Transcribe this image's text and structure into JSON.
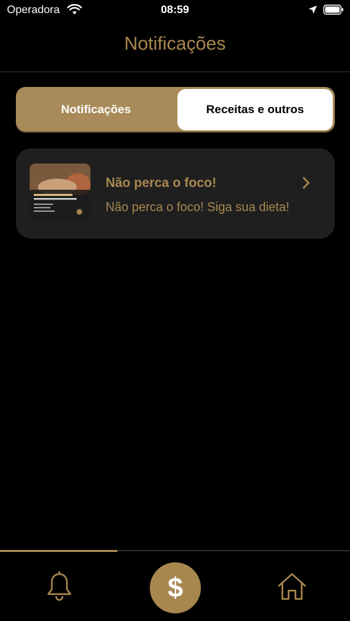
{
  "status_bar": {
    "carrier": "Operadora",
    "time": "08:59",
    "icons": [
      "wifi-icon",
      "location-arrow-icon",
      "battery-icon"
    ]
  },
  "header": {
    "title": "Notificações"
  },
  "segmented_control": {
    "tabs": [
      {
        "label": "Notificações",
        "selected": true
      },
      {
        "label": "Receitas e outros",
        "selected": false
      }
    ]
  },
  "notifications": [
    {
      "title": "Não perca o foco!",
      "body": "Não perca o foco! Siga sua dieta!",
      "thumbnail": "diet-promo-thumbnail",
      "action_icon": "chevron-right-icon"
    }
  ],
  "tab_bar": {
    "items": [
      {
        "icon": "bell-icon",
        "active": true
      },
      {
        "icon": "dollar-icon",
        "label": "$"
      },
      {
        "icon": "home-icon",
        "active": false
      }
    ]
  },
  "colors": {
    "background": "#000000",
    "accent_gold": "#a8874f",
    "segment_gold": "#a88b59",
    "card_bg": "#1f1f1f",
    "white": "#ffffff"
  }
}
